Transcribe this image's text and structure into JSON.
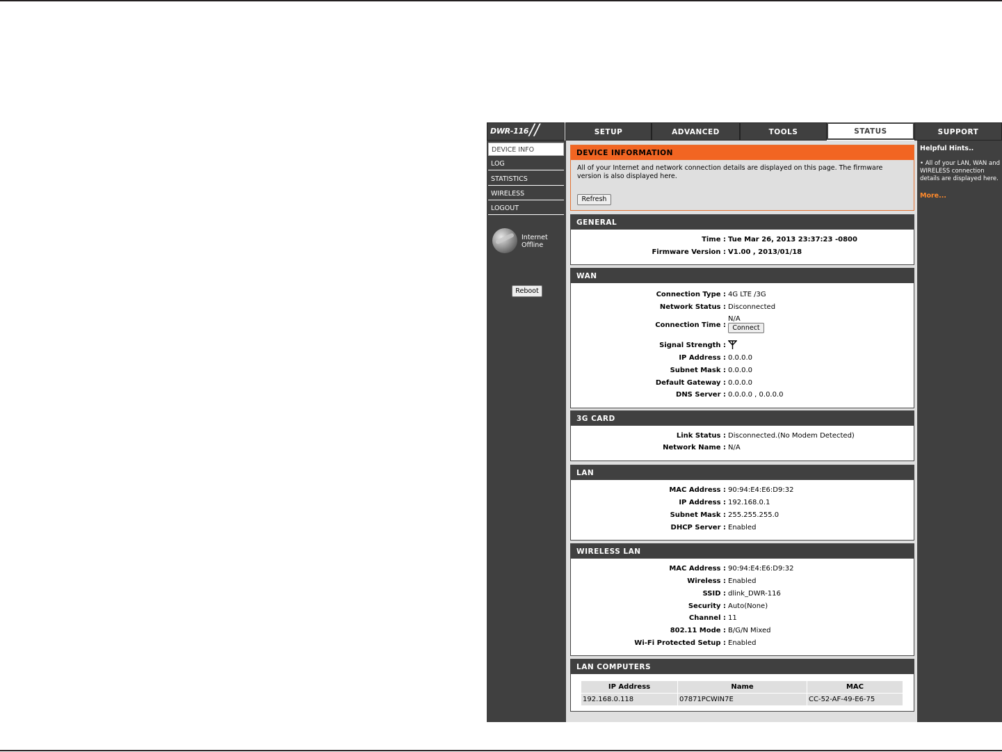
{
  "logo": {
    "model": "DWR-116"
  },
  "tabs": [
    "SETUP",
    "ADVANCED",
    "TOOLS",
    "STATUS",
    "SUPPORT"
  ],
  "sidebar": {
    "items": [
      "DEVICE INFO",
      "LOG",
      "STATISTICS",
      "WIRELESS",
      "LOGOUT"
    ],
    "internet_label": "Internet",
    "internet_status": "Offline",
    "reboot_label": "Reboot"
  },
  "hints": {
    "title": "Helpful Hints..",
    "body": "• All of your LAN, WAN and WIRELESS connection details are displayed here.",
    "more": "More..."
  },
  "device_info": {
    "title": "DEVICE INFORMATION",
    "text": "All of your Internet and network connection details are displayed on this page. The firmware version is also displayed here.",
    "refresh_label": "Refresh"
  },
  "general": {
    "title": "GENERAL",
    "time_label": "Time :",
    "time": "Tue Mar 26, 2013 23:37:23 -0800",
    "firmware_label": "Firmware Version :",
    "firmware": "V1.00 , 2013/01/18"
  },
  "wan": {
    "title": "WAN",
    "connection_type_label": "Connection Type :",
    "connection_type": "4G LTE /3G",
    "network_status_label": "Network Status :",
    "network_status": "Disconnected",
    "connection_time_label": "Connection Time :",
    "connection_time": "N/A",
    "connect_label": "Connect",
    "signal_label": "Signal Strength :",
    "ip_label": "IP Address :",
    "ip": "0.0.0.0",
    "subnet_label": "Subnet Mask :",
    "subnet": "0.0.0.0",
    "gateway_label": "Default Gateway :",
    "gateway": "0.0.0.0",
    "dns_label": "DNS Server :",
    "dns": "0.0.0.0 , 0.0.0.0"
  },
  "card3g": {
    "title": "3G CARD",
    "link_label": "Link Status :",
    "link": "Disconnected.(No Modem Detected)",
    "network_label": "Network Name :",
    "network": "N/A"
  },
  "lan": {
    "title": "LAN",
    "mac_label": "MAC Address :",
    "mac": "90:94:E4:E6:D9:32",
    "ip_label": "IP Address :",
    "ip": "192.168.0.1",
    "subnet_label": "Subnet Mask :",
    "subnet": "255.255.255.0",
    "dhcp_label": "DHCP Server :",
    "dhcp": "Enabled"
  },
  "wlan": {
    "title": "WIRELESS LAN",
    "mac_label": "MAC Address :",
    "mac": "90:94:E4:E6:D9:32",
    "wireless_label": "Wireless :",
    "wireless": "Enabled",
    "ssid_label": "SSID :",
    "ssid": "dlink_DWR-116",
    "security_label": "Security :",
    "security": "Auto(None)",
    "channel_label": "Channel :",
    "channel": "11",
    "mode_label": "802.11 Mode :",
    "mode": "B/G/N Mixed",
    "wps_label": "Wi-Fi Protected Setup :",
    "wps": "Enabled"
  },
  "lan_computers": {
    "title": "LAN COMPUTERS",
    "headers": [
      "IP Address",
      "Name",
      "MAC"
    ],
    "rows": [
      [
        "192.168.0.118",
        "07871PCWIN7E",
        "CC-52-AF-49-E6-75"
      ]
    ]
  }
}
